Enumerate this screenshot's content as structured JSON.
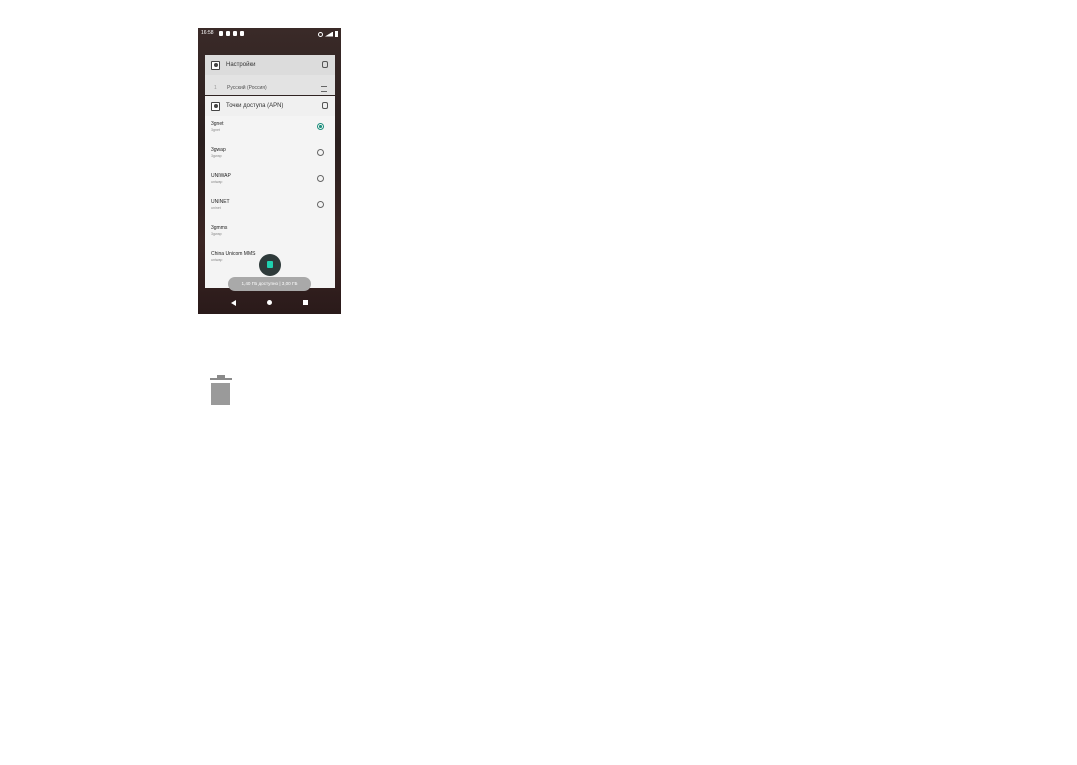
{
  "status_bar": {
    "time": "16:58",
    "left_icons": [
      "notification-icon",
      "notification-icon",
      "notification-icon",
      "notification-icon"
    ],
    "right_icons": [
      "mute-icon",
      "signal-icon",
      "battery-icon"
    ]
  },
  "recent_apps": [
    {
      "title": "Настройки",
      "row_number": "1",
      "row_label": "Русский (Россия)"
    },
    {
      "title": "Точки доступа (APN)",
      "apns": [
        {
          "name": "3gnet",
          "sub": "3gnet",
          "selected": true
        },
        {
          "name": "3gwap",
          "sub": "3gwap",
          "selected": false
        },
        {
          "name": "UNIWAP",
          "sub": "uniwap",
          "selected": false
        },
        {
          "name": "UNINET",
          "sub": "uninet",
          "selected": false
        },
        {
          "name": "3gmms",
          "sub": "3gwap",
          "selected": null
        },
        {
          "name": "China Unicom MMS",
          "sub": "uniwap",
          "selected": null
        }
      ]
    }
  ],
  "memory_label": "1,40 ГБ доступно | 3,00 ГБ",
  "colors": {
    "accent": "#1b8f7c",
    "fab_icon": "#1fd1b0",
    "wallpaper": "#2a1f1e"
  }
}
